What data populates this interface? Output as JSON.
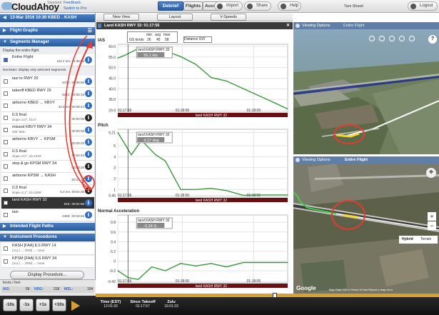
{
  "app": {
    "name": "CloudAhoy",
    "edition": "Standard",
    "feedback": "Feedback",
    "switch_pro": "Switch to Pro"
  },
  "tabs": [
    {
      "label": "Debrief"
    },
    {
      "label": "Flights"
    },
    {
      "label": "Account"
    }
  ],
  "actions": {
    "import": "Import",
    "share": "Share",
    "help": "Help",
    "logout": "Logout"
  },
  "user": "Tani Shavit",
  "flight": {
    "title": "13-Mar 2016 10:30   KBED→KASH"
  },
  "sidebar": {
    "flight_graphs": "Flight Graphs",
    "segments_manager": "Segments Manager",
    "display_entire": "Display the entire flight",
    "entire_flight": {
      "name": "Entire Flight",
      "detail": "122.4 nm, 01:35:06"
    },
    "declutter": "Declutter: display only selected segments",
    "segments": [
      {
        "name": "taxi to RWY 29",
        "sub": "",
        "detail": "6471', 00:05:59"
      },
      {
        "name": "takeoff KBED RWY 29",
        "sub": "",
        "detail": "6441', 00:00:15"
      },
      {
        "name": "airborne KBED → KBVY",
        "sub": "",
        "detail": "33.2 nm, 00:09:44"
      },
      {
        "name": "ILS final",
        "sub": "slope=3.0°, fd=0'",
        "detail": "00:02:06"
      },
      {
        "name": "missed KBVY RWY 34",
        "sub": "404' MSL",
        "detail": "00:00:05"
      },
      {
        "name": "airborne KBVY → KPSM",
        "sub": "",
        "detail": "00:00:25"
      },
      {
        "name": "ILS final",
        "sub": "slope=3.0°, td=1310'",
        "detail": "00:04:34"
      },
      {
        "name": "stop & go KPSM RWY 34",
        "sub": "",
        "detail": "00:00:26"
      },
      {
        "name": "airborne KPSM → KASH",
        "sub": "",
        "detail": "00:23:14"
      },
      {
        "name": "ILS final",
        "sub": "slope=3.1°, fd=1065'",
        "detail": "5.3 nm, 00:04:26"
      },
      {
        "name": "land KASH RWY 32",
        "sub": "",
        "detail": "815', 00:01:56"
      },
      {
        "name": "taxi",
        "sub": "",
        "detail": "2359', 00:03:26"
      }
    ],
    "intended_paths": "Intended Flight Paths",
    "instrument_procedures": "Instrument Procedures",
    "procedures": [
      {
        "name": "KASH [FAA] ILS RWY 14",
        "sub": "(ALL) → (RW) → none"
      },
      {
        "name": "KPSM [FAA] ILS RWY 34",
        "sub": "(ALL) → (RW) → none"
      }
    ],
    "display_procedure": "Display Procedure...",
    "knots_label": "knots / feet",
    "ias_label": "IAS:",
    "ias_val": "56",
    "hdg_label": "HDG:",
    "hdg_val": "318",
    "msl_label": "MSL:",
    "msl_val": "194"
  },
  "center": {
    "new_view": "New View",
    "layout": "Layout",
    "vspeeds": "V-Speeds",
    "chart_title": "Land KASH RWY 32: 01:17:56"
  },
  "stats": {
    "header": [
      "min",
      "avg",
      "max"
    ],
    "row_label": "GS knots",
    "values": [
      "26",
      "45",
      "58"
    ],
    "distance_label": "Distance",
    "distance": "915'"
  },
  "chart_data": [
    {
      "type": "line",
      "title": "IAS",
      "ylim": [
        29,
        61
      ],
      "yticks": [
        "60.0",
        "55.0",
        "50.0",
        "45.0",
        "40.0",
        "35.0",
        "29.9"
      ],
      "xticks": [
        "01:17:56",
        "01:18:00",
        "01:18:05"
      ],
      "band": "land KASH RWY 32",
      "tooltip_title": "land KASH RWY 32",
      "tooltip_value": "56.1 kts",
      "x": [
        0,
        0.05,
        0.12,
        0.2,
        0.28,
        0.37,
        0.46,
        0.55,
        0.64,
        0.74,
        0.86,
        1.0
      ],
      "y": [
        54.5,
        56.1,
        59.0,
        58.7,
        57.8,
        55.2,
        51.5,
        45.3,
        43.7,
        40.0,
        35.7,
        30.5
      ]
    },
    {
      "type": "line",
      "title": "Pitch",
      "ylim": [
        0.3,
        6.5
      ],
      "yticks": [
        "6.21",
        "5",
        "4",
        "3",
        "2",
        "1",
        "0.46"
      ],
      "xticks": [
        "01:17:56",
        "01:18:00",
        "01:18:05"
      ],
      "band": "land KASH RWY 32",
      "tooltip_title": "land KASH RWY 32",
      "tooltip_value": "4.17 deg",
      "x": [
        0,
        0.08,
        0.14,
        0.22,
        0.28,
        0.37,
        0.46,
        0.55,
        0.64,
        0.74,
        0.86,
        1.0
      ],
      "y": [
        6.21,
        4.17,
        5.5,
        4.2,
        3.6,
        1.0,
        1.0,
        1.1,
        0.9,
        0.46,
        0.5,
        0.5
      ]
    },
    {
      "type": "line",
      "title": "Normal Acceleration",
      "ylim": [
        -0.45,
        0.95
      ],
      "yticks": [
        "0.8",
        "0.6",
        "0.4",
        "0.2",
        "0",
        "-0.2",
        "-0.42"
      ],
      "xticks": [
        "01:17:56",
        "01:18:00",
        "01:18:05"
      ],
      "band": "land KASH RWY 32",
      "tooltip_title": "land KASH RWY 32",
      "tooltip_value": "-0.34 G",
      "x": [
        0,
        0.06,
        0.12,
        0.2,
        0.28,
        0.37,
        0.46,
        0.55,
        0.64,
        0.74,
        0.86,
        1.0
      ],
      "y": [
        -0.2,
        -0.34,
        -0.38,
        -0.12,
        -0.2,
        -0.05,
        -0.1,
        -0.05,
        -0.12,
        -0.03,
        -0.03,
        -0.03
      ]
    }
  ],
  "map3d": {
    "viewing_options": "Viewing Options",
    "label": "Entire Flight"
  },
  "map2d": {
    "viewing_options": "Viewing Options",
    "label": "Entire Flight",
    "hybrid": "Hybrid",
    "terrain": "Terrain",
    "google": "Google",
    "attribution": "Map Data  100 m  Terms of Use  Report a map error"
  },
  "timeline": {
    "buttons": [
      "-10s",
      "-1s",
      "+1s",
      "+10s"
    ],
    "time_label": "Time (EST)",
    "time_val": "12:01:33",
    "since_label": "Since Takeoff",
    "since_val": "01:17:57",
    "zulu_label": "Zulu",
    "zulu_val": "16:01:33"
  },
  "colors": {
    "accent_blue": "#2d6ac4",
    "line_green": "#3a9a3a",
    "band": "#6b0f12",
    "annotation_red": "#e63b2e"
  }
}
